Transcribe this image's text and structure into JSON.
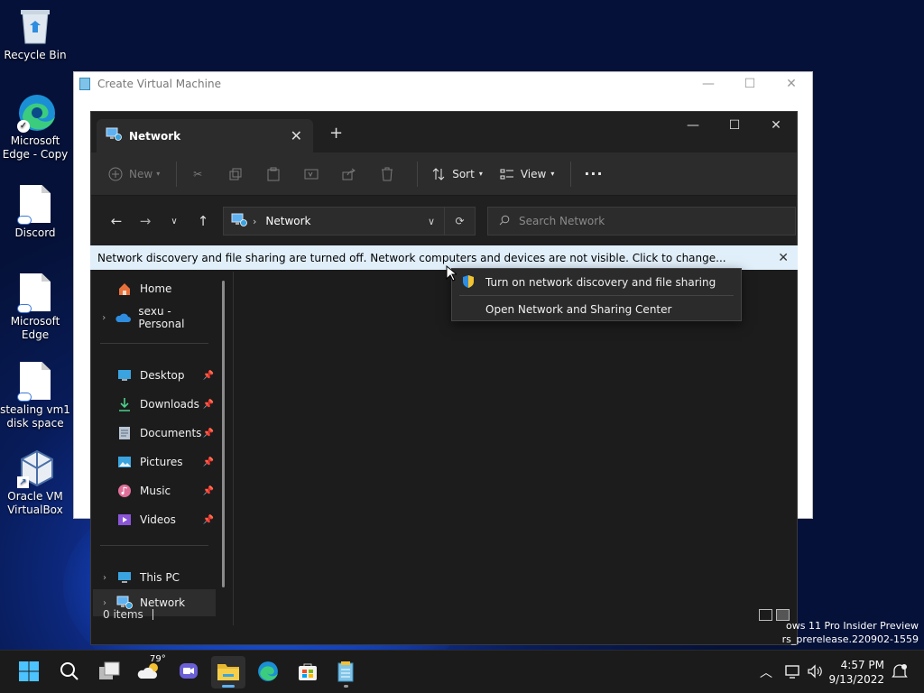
{
  "desktop": {
    "icons": [
      {
        "label": "Recycle Bin"
      },
      {
        "label": "Microsoft Edge - Copy"
      },
      {
        "label": "Discord"
      },
      {
        "label": "Microsoft Edge"
      },
      {
        "label": "stealing vm1 disk space"
      },
      {
        "label": "Oracle VM VirtualBox"
      }
    ],
    "watermark_line1": "ows 11 Pro Insider Preview",
    "watermark_line2": "rs_prerelease.220902-1559"
  },
  "vm_window": {
    "title": "Create Virtual Machine"
  },
  "explorer": {
    "tab_title": "Network",
    "new_tab": "+",
    "commands": {
      "new_label": "New",
      "sort_label": "Sort",
      "view_label": "View",
      "more_label": "···"
    },
    "address": {
      "location": "Network"
    },
    "search": {
      "placeholder": "Search Network"
    },
    "infobar": {
      "message": "Network discovery and file sharing are turned off. Network computers and devices are not visible. Click to change..."
    },
    "sidebar": {
      "items": [
        {
          "label": "Home"
        },
        {
          "label": "sexu - Personal"
        },
        {
          "label": "Desktop"
        },
        {
          "label": "Downloads"
        },
        {
          "label": "Documents"
        },
        {
          "label": "Pictures"
        },
        {
          "label": "Music"
        },
        {
          "label": "Videos"
        },
        {
          "label": "This PC"
        },
        {
          "label": "Network"
        }
      ]
    },
    "status": {
      "items_count": "0 items"
    }
  },
  "context_menu": {
    "items": [
      {
        "label": "Turn on network discovery and file sharing"
      },
      {
        "label": "Open Network and Sharing Center"
      }
    ]
  },
  "taskbar": {
    "weather_temp": "79°",
    "time": "4:57 PM",
    "date": "9/13/2022"
  },
  "colors": {
    "accent": "#5fb2f2",
    "infobar_bg": "#e1effa",
    "explorer_bg": "#1c1c1c"
  }
}
